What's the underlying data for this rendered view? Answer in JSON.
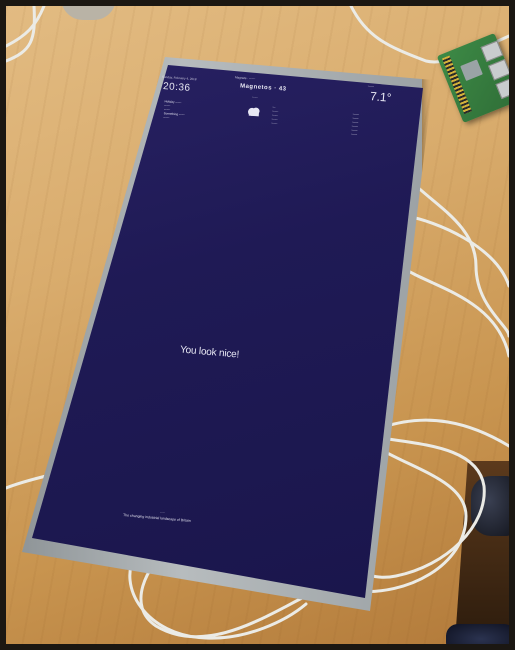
{
  "scene": {
    "description_colors": {
      "table": "#d9ac6d",
      "screen": "#1f1a55",
      "bezel": "#a8aeb1",
      "cable": "#e9e9e4",
      "board": "#3d8a46"
    }
  },
  "mirror": {
    "clock": {
      "date": "Sunday, February 4, 2018",
      "time": "20:36"
    },
    "calendar": {
      "items": [
        "Holiday ——",
        "——",
        "——",
        "Something ——",
        "——"
      ]
    },
    "newsfeed": {
      "source": "Magnets · ——",
      "headline": "Magnetos · 43",
      "subhead": "——",
      "rows": [
        "—",
        "——",
        "——",
        "——",
        "——"
      ]
    },
    "weather": {
      "location": "——",
      "temperature": "7.1°",
      "rows": [
        "——",
        "——",
        "——",
        "——",
        "——",
        "——"
      ]
    },
    "compliment": "You look nice!",
    "footer": {
      "label": "——",
      "text": "The changing industrial landscape of Britain"
    }
  }
}
